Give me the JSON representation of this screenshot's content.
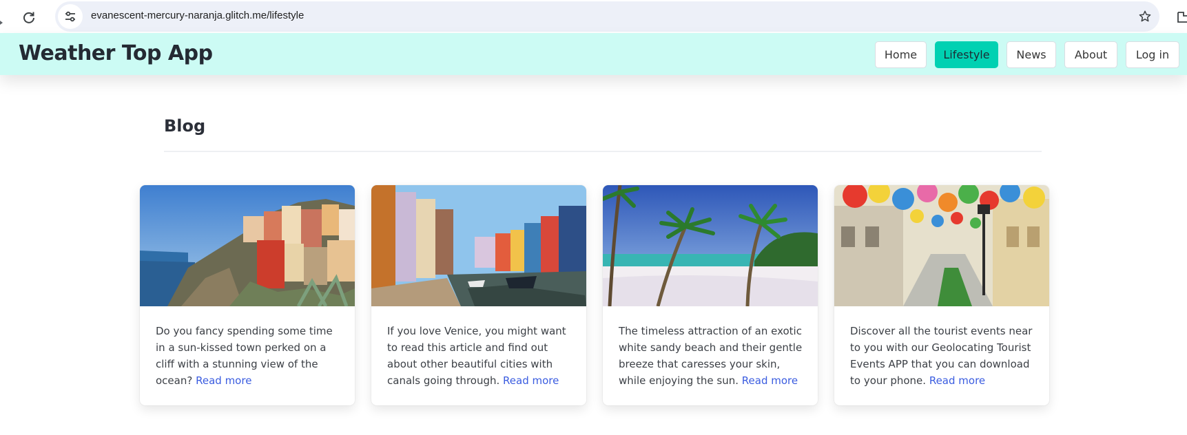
{
  "browser": {
    "url": "evanescent-mercury-naranja.glitch.me/lifestyle",
    "icons": [
      "back-icon",
      "reload-icon",
      "site-info-icon",
      "bookmark-star-icon",
      "extensions-icon"
    ]
  },
  "navbar": {
    "brand": "Weather Top App",
    "items": [
      {
        "label": "Home",
        "active": false
      },
      {
        "label": "Lifestyle",
        "active": true
      },
      {
        "label": "News",
        "active": false
      },
      {
        "label": "About",
        "active": false
      },
      {
        "label": "Log in",
        "active": false
      }
    ],
    "colors": {
      "bar": "#ccfbf4",
      "active": "#00d1b2"
    }
  },
  "main": {
    "heading": "Blog",
    "cards": [
      {
        "image": "colorful cliffside town by the sea",
        "text": "Do you fancy spending some time in a sun-kissed town perked on a cliff with a stunning view of the ocean?",
        "link": "Read more"
      },
      {
        "image": "venetian canal with colorful houses and boats",
        "text": "If you love Venice, you might want to read this article and find out about other beautiful cities with canals going through.",
        "link": "Read more"
      },
      {
        "image": "tropical white sandy beach with palm trees",
        "text": "The timeless attraction of an exotic white sandy beach and their gentle breeze that caresses your skin, while enjoying the sun.",
        "link": "Read more"
      },
      {
        "image": "street covered by colorful umbrellas",
        "text": "Discover all the tourist events near to you with our Geolocating Tourist Events APP that you can download to your phone.",
        "link": "Read more"
      }
    ],
    "link_color": "#3a5ce0"
  }
}
